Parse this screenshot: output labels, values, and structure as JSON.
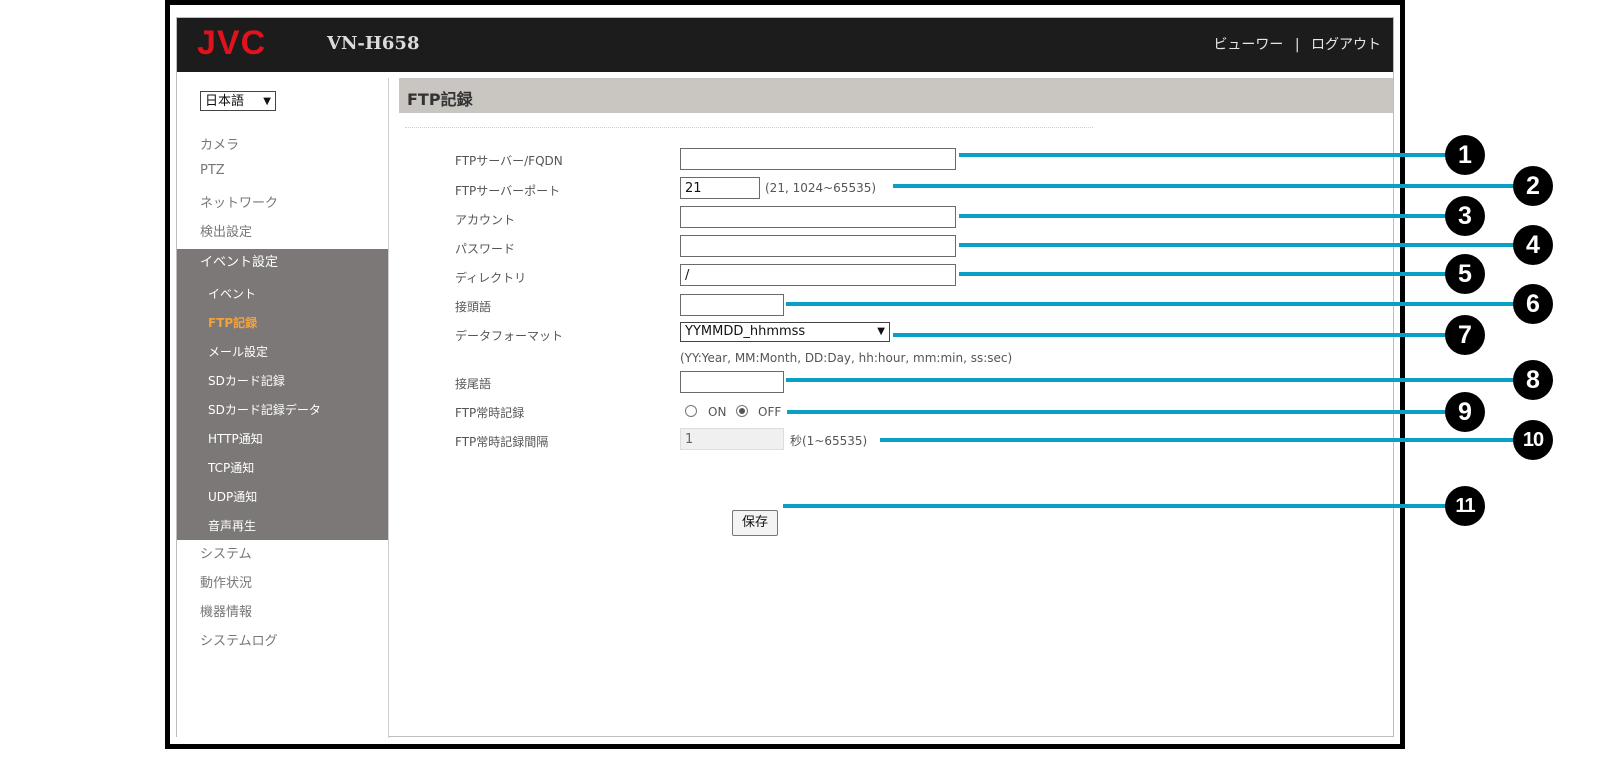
{
  "header": {
    "logo": "JVC",
    "model": "VN-H658",
    "viewer_link": "ビューワー",
    "separator": "|",
    "logout_link": "ログアウト"
  },
  "sidebar": {
    "language": "日本語",
    "items_top": [
      "カメラ",
      "PTZ",
      "ネットワーク",
      "検出設定"
    ],
    "group_head": "イベント設定",
    "group_items": [
      "イベント",
      "FTP記録",
      "メール設定",
      "SDカード記録",
      "SDカード記録データ",
      "HTTP通知",
      "TCP通知",
      "UDP通知",
      "音声再生"
    ],
    "items_bottom": [
      "システム",
      "動作状況",
      "機器情報",
      "システムログ"
    ]
  },
  "page": {
    "title": "FTP記録",
    "fields": {
      "server_label": "FTPサーバー/FQDN",
      "server_value": "",
      "port_label": "FTPサーバーポート",
      "port_value": "21",
      "port_hint": "(21, 1024~65535)",
      "account_label": "アカウント",
      "account_value": "",
      "password_label": "パスワード",
      "password_value": "",
      "directory_label": "ディレクトリ",
      "directory_value": "/",
      "prefix_label": "接頭語",
      "prefix_value": "",
      "format_label": "データフォーマット",
      "format_value": "YYMMDD_hhmmss",
      "format_hint": "(YY:Year, MM:Month, DD:Day, hh:hour, mm:min, ss:sec)",
      "suffix_label": "接尾語",
      "suffix_value": "",
      "continuous_label": "FTP常時記録",
      "on_label": "ON",
      "off_label": "OFF",
      "continuous_selected": "OFF",
      "interval_label": "FTP常時記録間隔",
      "interval_value": "1",
      "interval_hint": "秒(1~65535)"
    },
    "save_label": "保存"
  },
  "callouts": [
    "1",
    "2",
    "3",
    "4",
    "5",
    "6",
    "7",
    "8",
    "9",
    "10",
    "11"
  ],
  "colors": {
    "accent": "#0aa0c4",
    "logo": "#e0121b",
    "active_nav": "#f2a23a",
    "nav_group_bg": "#7d7878"
  }
}
